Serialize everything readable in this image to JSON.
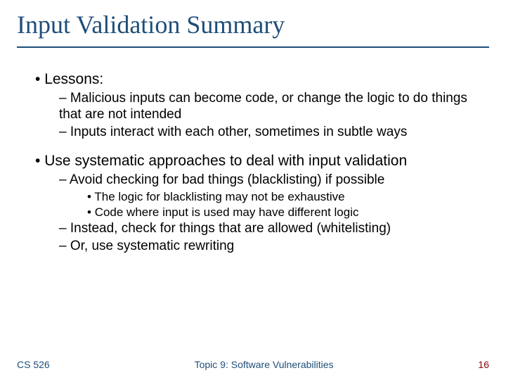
{
  "title": "Input Validation Summary",
  "bullets": {
    "b1": "Lessons:",
    "b1_1": "Malicious inputs can become code, or change the logic to do things that are not intended",
    "b1_2": "Inputs interact with each other, sometimes in subtle ways",
    "b2": "Use systematic approaches to deal with input validation",
    "b2_1": "Avoid checking for bad things (blacklisting) if possible",
    "b2_1_1": "The logic for blacklisting may not be exhaustive",
    "b2_1_2": "Code where input is used may have different logic",
    "b2_2": "Instead, check for things that are allowed (whitelisting)",
    "b2_3": "Or, use systematic rewriting"
  },
  "footer": {
    "left": "CS 526",
    "center": "Topic 9: Software Vulnerabilities",
    "right": "16"
  }
}
